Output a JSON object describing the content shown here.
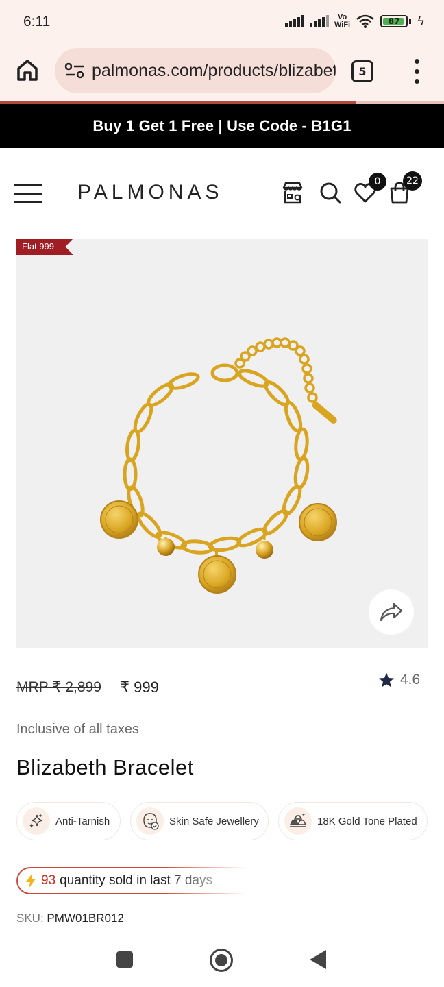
{
  "status_bar": {
    "time": "6:11",
    "vowifi_line1": "Vo",
    "vowifi_line2": "WiFi",
    "battery_level": "87"
  },
  "browser": {
    "url": "palmonas.com/products/blizabeth",
    "tab_count": "5"
  },
  "promo": {
    "text": "Buy 1 Get 1 Free | Use Code - B1G1"
  },
  "header": {
    "logo": "PALMONAS",
    "wishlist_count": "0",
    "cart_count": "22"
  },
  "product": {
    "badge": "Flat 999",
    "mrp": "MRP ₹ 2,899",
    "price": "₹ 999",
    "rating": "4.6",
    "taxes_note": "Inclusive of all taxes",
    "title": "Blizabeth Bracelet",
    "features": [
      {
        "label": "Anti-Tarnish",
        "icon": "sparkle-icon"
      },
      {
        "label": "Skin Safe Jewellery",
        "icon": "skin-safe-icon"
      },
      {
        "label": "18K Gold Tone Plated",
        "icon": "gold-bars-icon"
      }
    ],
    "sold": {
      "count": "93",
      "text": "quantity sold in last 7 days"
    },
    "sku_label": "SKU:",
    "sku_value": "PMW01BR012"
  },
  "colors": {
    "promo_bg": "#000000",
    "badge_red": "#a01e23",
    "sold_red": "#d02a1e",
    "chrome_bg": "#fdf1ee",
    "url_bg": "#f6ded8",
    "gold": "#d9a521"
  }
}
